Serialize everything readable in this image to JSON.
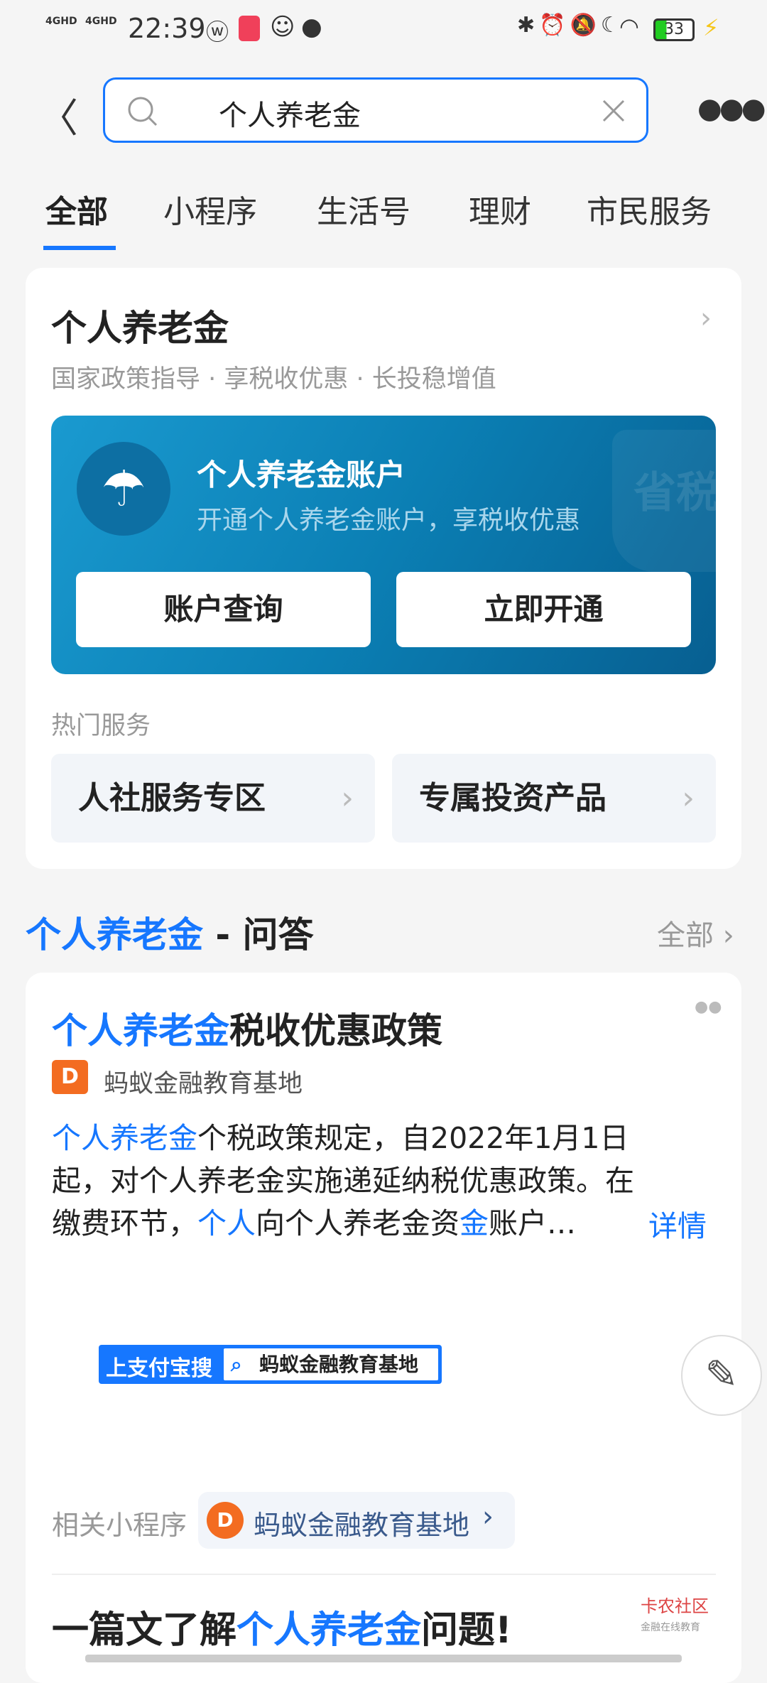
{
  "status_bar": {
    "time": "22:39",
    "network1": "4GHD",
    "network2": "4GHD",
    "battery": "33"
  },
  "search": {
    "query": "个人养老金"
  },
  "tabs": [
    {
      "label": "全部",
      "active": true
    },
    {
      "label": "小程序"
    },
    {
      "label": "生活号"
    },
    {
      "label": "理财"
    },
    {
      "label": "市民服务"
    }
  ],
  "main_card": {
    "title": "个人养老金",
    "subtitle": "国家政策指导 · 享税收优惠 · 长投稳增值",
    "banner": {
      "title": "个人养老金账户",
      "subtitle": "开通个人养老金账户，享税收优惠",
      "watermark": "省税",
      "btn_query": "账户查询",
      "btn_open": "立即开通"
    },
    "hot_label": "热门服务",
    "services": [
      "人社服务专区",
      "专属投资产品"
    ]
  },
  "qa_section": {
    "title_highlight": "个人养老金",
    "title_rest": " - 问答",
    "all_label": "全部"
  },
  "qa_card": {
    "title_highlight": "个人养老金",
    "title_rest": "税收优惠政策",
    "source": "蚂蚁金融教育基地",
    "lines": [
      [
        {
          "t": "个人养老金",
          "h": true
        },
        {
          "t": "个税政策规定，自2022年1月1日"
        }
      ],
      [
        {
          "t": "起，对个人养老金实施递延纳税优惠政策。在"
        }
      ],
      [
        {
          "t": "缴费环节，"
        },
        {
          "t": "个人",
          "h": true
        },
        {
          "t": "向个人养老金资"
        },
        {
          "t": "金",
          "h": true
        },
        {
          "t": "账户…"
        }
      ]
    ],
    "detail_label": "详情",
    "promo": {
      "left": "上支付宝搜",
      "right": "蚂蚁金融教育基地"
    },
    "related_label": "相关小程序",
    "related_name": "蚂蚁金融教育基地"
  },
  "article": {
    "pre": "一篇文了解",
    "highlight": "个人养老金",
    "post": "问题!"
  },
  "watermark": {
    "name": "卡农社区",
    "tagline": "金融在线教育"
  },
  "colors": {
    "accent": "#1677ff",
    "banner": "#0b7fb4"
  }
}
